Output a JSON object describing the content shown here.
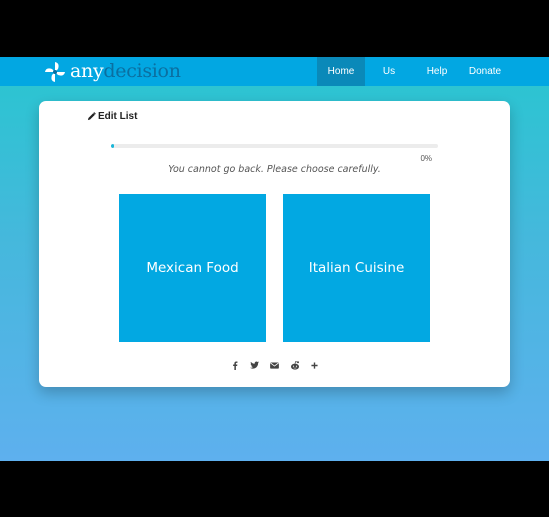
{
  "navbar": {
    "brand_any": "any",
    "brand_decision": "decision",
    "items": [
      {
        "label": "Home",
        "active": true
      },
      {
        "label": "Us",
        "active": false
      },
      {
        "label": "Help",
        "active": false
      },
      {
        "label": "Donate",
        "active": false
      }
    ]
  },
  "card": {
    "edit_label": "Edit List",
    "progress_percent": 0,
    "progress_label": "0%",
    "warning": "You cannot go back. Please choose carefully.",
    "choices": [
      {
        "label": "Mexican Food"
      },
      {
        "label": "Italian Cuisine"
      }
    ],
    "share_icons": [
      "facebook-icon",
      "twitter-icon",
      "email-icon",
      "reddit-icon",
      "plus-icon"
    ]
  },
  "colors": {
    "navbar": "#02a7e2",
    "nav_active": "#0a89b9",
    "choice_tile": "#02a8e2",
    "progress": "#1ab6d8",
    "gradient_top": "#28c6d0",
    "gradient_bottom": "#5eb0ee"
  }
}
